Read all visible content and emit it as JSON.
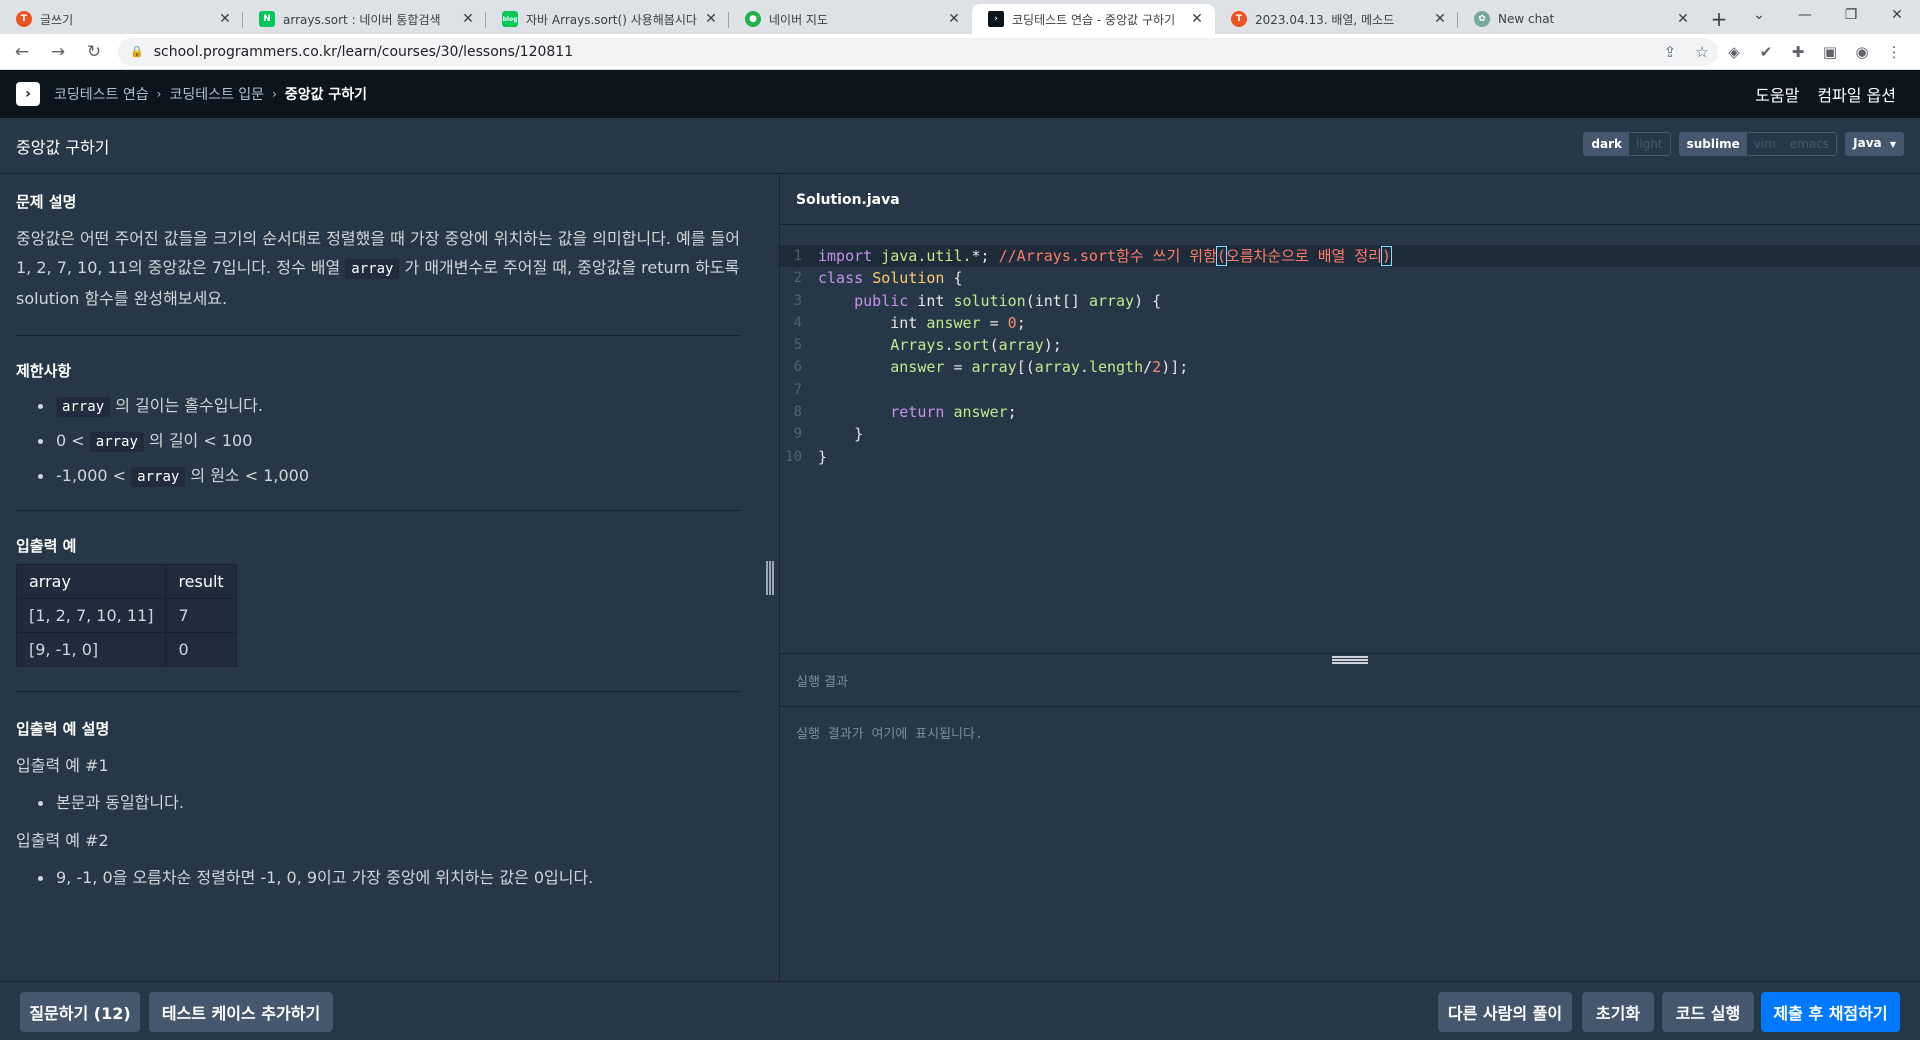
{
  "browser": {
    "tabs": [
      {
        "title": "글쓰기",
        "icon": "tistory-icon",
        "color": "#eb531f"
      },
      {
        "title": "arrays.sort : 네이버 통합검색",
        "icon": "naver-icon",
        "color": "#03c75a"
      },
      {
        "title": "자바 Arrays.sort() 사용해봅시다",
        "icon": "blog-icon",
        "color": "#03c75a"
      },
      {
        "title": "네이버 지도",
        "icon": "naver-map-icon",
        "color": "#20b04d"
      },
      {
        "title": "코딩테스트 연습 - 중앙값 구하기",
        "icon": "programmers-icon",
        "color": "#0c151c",
        "active": true
      },
      {
        "title": "2023.04.13. 배열, 메소드",
        "icon": "tistory-icon",
        "color": "#eb531f"
      },
      {
        "title": "New chat",
        "icon": "chatgpt-icon",
        "color": "#74aa9c"
      }
    ],
    "url": "school.programmers.co.kr/learn/courses/30/lessons/120811"
  },
  "header": {
    "breadcrumbs": [
      "코딩테스트 연습",
      "코딩테스트 입문",
      "중앙값 구하기"
    ],
    "help": "도움말",
    "compile_options": "컴파일 옵션"
  },
  "titlebar": {
    "title": "중앙값 구하기",
    "theme": [
      "dark",
      "light"
    ],
    "keymap": [
      "sublime",
      "vim",
      "emacs"
    ],
    "language": "Java"
  },
  "problem": {
    "desc_title": "문제 설명",
    "desc_1": "중앙값은 어떤 주어진 값들을 크기의 순서대로 정렬했을 때 가장 중앙에 위치하는 값을 의미합니다. 예를 들어 1, 2, 7, 10, 11의 중앙값은 7입니다. 정수 배열 ",
    "desc_code": "array",
    "desc_2": " 가 매개변수로 주어질 때, 중앙값을 return 하도록 solution 함수를 완성해보세요.",
    "limits_title": "제한사항",
    "limits": [
      {
        "pre": "",
        "code": "array",
        "post": " 의 길이는 홀수입니다."
      },
      {
        "pre": "0 < ",
        "code": "array",
        "post": " 의 길이 < 100"
      },
      {
        "pre": "-1,000 < ",
        "code": "array",
        "post": " 의 원소 < 1,000"
      }
    ],
    "io_title": "입출력 예",
    "io_headers": [
      "array",
      "result"
    ],
    "io_rows": [
      [
        "[1, 2, 7, 10, 11]",
        "7"
      ],
      [
        "[9, -1, 0]",
        "0"
      ]
    ],
    "io_desc_title": "입출력 예 설명",
    "ex1_title": "입출력 예 #1",
    "ex1_items": [
      "본문과 동일합니다."
    ],
    "ex2_title": "입출력 예 #2",
    "ex2_items": [
      "9, -1, 0을 오름차순 정렬하면 -1, 0, 9이고 가장 중앙에 위치하는 값은 0입니다."
    ]
  },
  "editor": {
    "filename": "Solution.java",
    "line_numbers": [
      "1",
      "2",
      "3",
      "4",
      "5",
      "6",
      "7",
      "8",
      "9",
      "10"
    ]
  },
  "result": {
    "title": "실행 결과",
    "placeholder": "실행 결과가 여기에 표시됩니다."
  },
  "footer": {
    "ask": "질문하기 (12)",
    "add_testcase": "테스트 케이스 추가하기",
    "others": "다른 사람의 풀이",
    "reset": "초기화",
    "run": "코드 실행",
    "submit": "제출 후 채점하기"
  }
}
